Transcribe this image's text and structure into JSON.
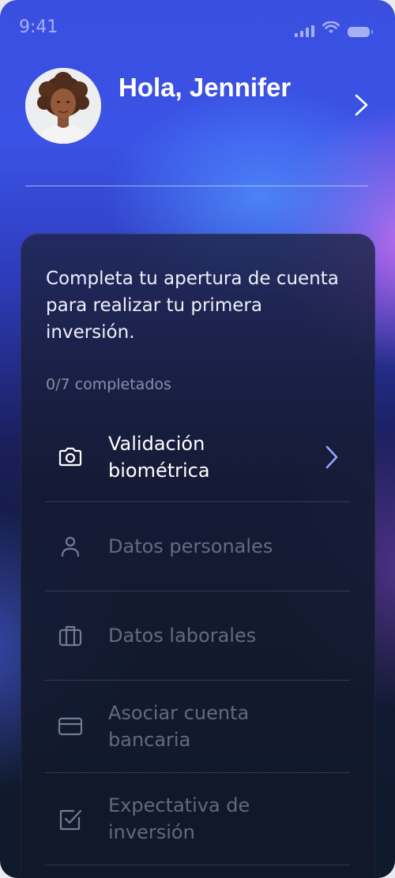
{
  "status_bar": {
    "time": "9:41",
    "icons": [
      "cellular-signal-icon",
      "wifi-icon",
      "battery-icon"
    ]
  },
  "header": {
    "greeting": "Hola, Jennifer",
    "avatar": "user-avatar",
    "chevron": "chevron-right-icon"
  },
  "card": {
    "message": "Completa tu apertura de cuenta para realizar tu primera inversión.",
    "progress": "0/7 completados",
    "steps": [
      {
        "label": "Validación biométrica",
        "icon": "camera-icon",
        "state": "active"
      },
      {
        "label": "Datos personales",
        "icon": "user-icon",
        "state": "disabled"
      },
      {
        "label": "Datos laborales",
        "icon": "briefcase-icon",
        "state": "disabled"
      },
      {
        "label": "Asociar cuenta bancaria",
        "icon": "credit-card-icon",
        "state": "disabled"
      },
      {
        "label": "Expectativa de inversión",
        "icon": "checkbox-icon",
        "state": "disabled"
      }
    ]
  },
  "colors": {
    "accent_chevron": "#8fa6ff",
    "text_active": "#ffffff",
    "text_disabled": "#737a94"
  }
}
